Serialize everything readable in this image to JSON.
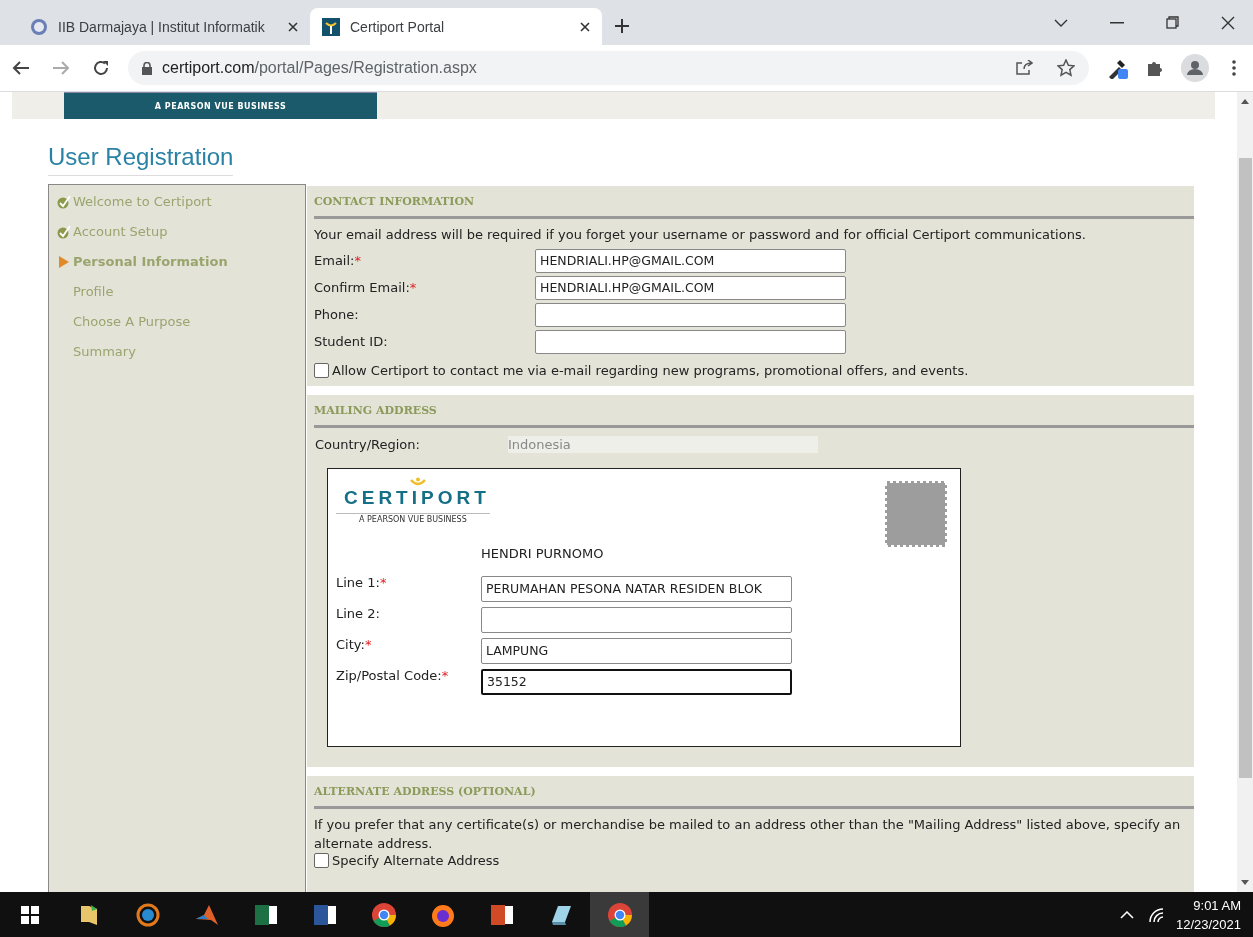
{
  "browser": {
    "tabs": [
      {
        "title": "IIB Darmajaya | Institut Informatik",
        "kind": "college",
        "selected": false
      },
      {
        "title": "Certiport Portal",
        "kind": "certiport",
        "selected": true
      }
    ],
    "url_host": "certiport.com",
    "url_path": "/portal/Pages/Registration.aspx"
  },
  "page": {
    "banner_text": "A PEARSON VUE BUSINESS",
    "heading": "User Registration",
    "steps": [
      {
        "label": "Welcome to Certiport",
        "checked": true,
        "selected": false
      },
      {
        "label": "Account Setup",
        "checked": true,
        "selected": false
      },
      {
        "label": "Personal Information",
        "checked": false,
        "selected": true
      },
      {
        "label": "Profile",
        "checked": false,
        "selected": false
      },
      {
        "label": "Choose A Purpose",
        "checked": false,
        "selected": false
      },
      {
        "label": "Summary",
        "checked": false,
        "selected": false
      }
    ],
    "contact": {
      "title": "CONTACT INFORMATION",
      "intro": "Your email address will be required if you forget your username or password and for official Certiport communications.",
      "fields": [
        {
          "label": "Email:",
          "required_mark": "*",
          "value": "HENDRIALI.HP@GMAIL.COM"
        },
        {
          "label": "Confirm Email:",
          "required_mark": "*",
          "value": "HENDRIALI.HP@GMAIL.COM"
        },
        {
          "label": "Phone:"
        },
        {
          "label": "Student ID:"
        }
      ],
      "opt_in": {
        "label": "Allow Certiport to contact me via e-mail regarding new programs, promotional offers, and events.",
        "checked": false
      }
    },
    "mailing": {
      "title": "MAILING ADDRESS",
      "country_label": "Country/Region:",
      "country_value": "Indonesia",
      "logo_word": "CERTIPORT",
      "logo_sub": "A PEARSON VUE BUSINESS",
      "name": "HENDRI PURNOMO",
      "fields": [
        {
          "label": "Line 1:",
          "required_mark": "*",
          "value": "PERUMAHAN PESONA NATAR RESIDEN BLOK",
          "focused": false
        },
        {
          "label": "Line 2:",
          "focused": false
        },
        {
          "label": "City:",
          "required_mark": "*",
          "value": "LAMPUNG",
          "focused": false
        },
        {
          "label": "Zip/Postal Code:",
          "required_mark": "*",
          "value": "35152",
          "focused": true
        }
      ]
    },
    "alternate": {
      "title": "ALTERNATE ADDRESS (OPTIONAL)",
      "text": "If you prefer that any certificate(s) or merchandise be mailed to an address other than the \"Mailing Address\" listed above, specify an alternate address.",
      "checkbox": {
        "label": "Specify Alternate Address",
        "checked": false
      }
    }
  },
  "taskbar": {
    "apps": [
      {
        "kind": "folder",
        "active": false
      },
      {
        "kind": "target",
        "active": false
      },
      {
        "kind": "matlab",
        "active": false
      },
      {
        "kind": "excel",
        "active": false
      },
      {
        "kind": "word",
        "active": false
      },
      {
        "kind": "chrome",
        "active": false
      },
      {
        "kind": "firefox",
        "active": false
      },
      {
        "kind": "powerpoint",
        "active": false
      },
      {
        "kind": "notepad",
        "active": false
      },
      {
        "kind": "chrome",
        "active": true
      }
    ],
    "time": "9:01 AM",
    "date": "12/23/2021"
  }
}
